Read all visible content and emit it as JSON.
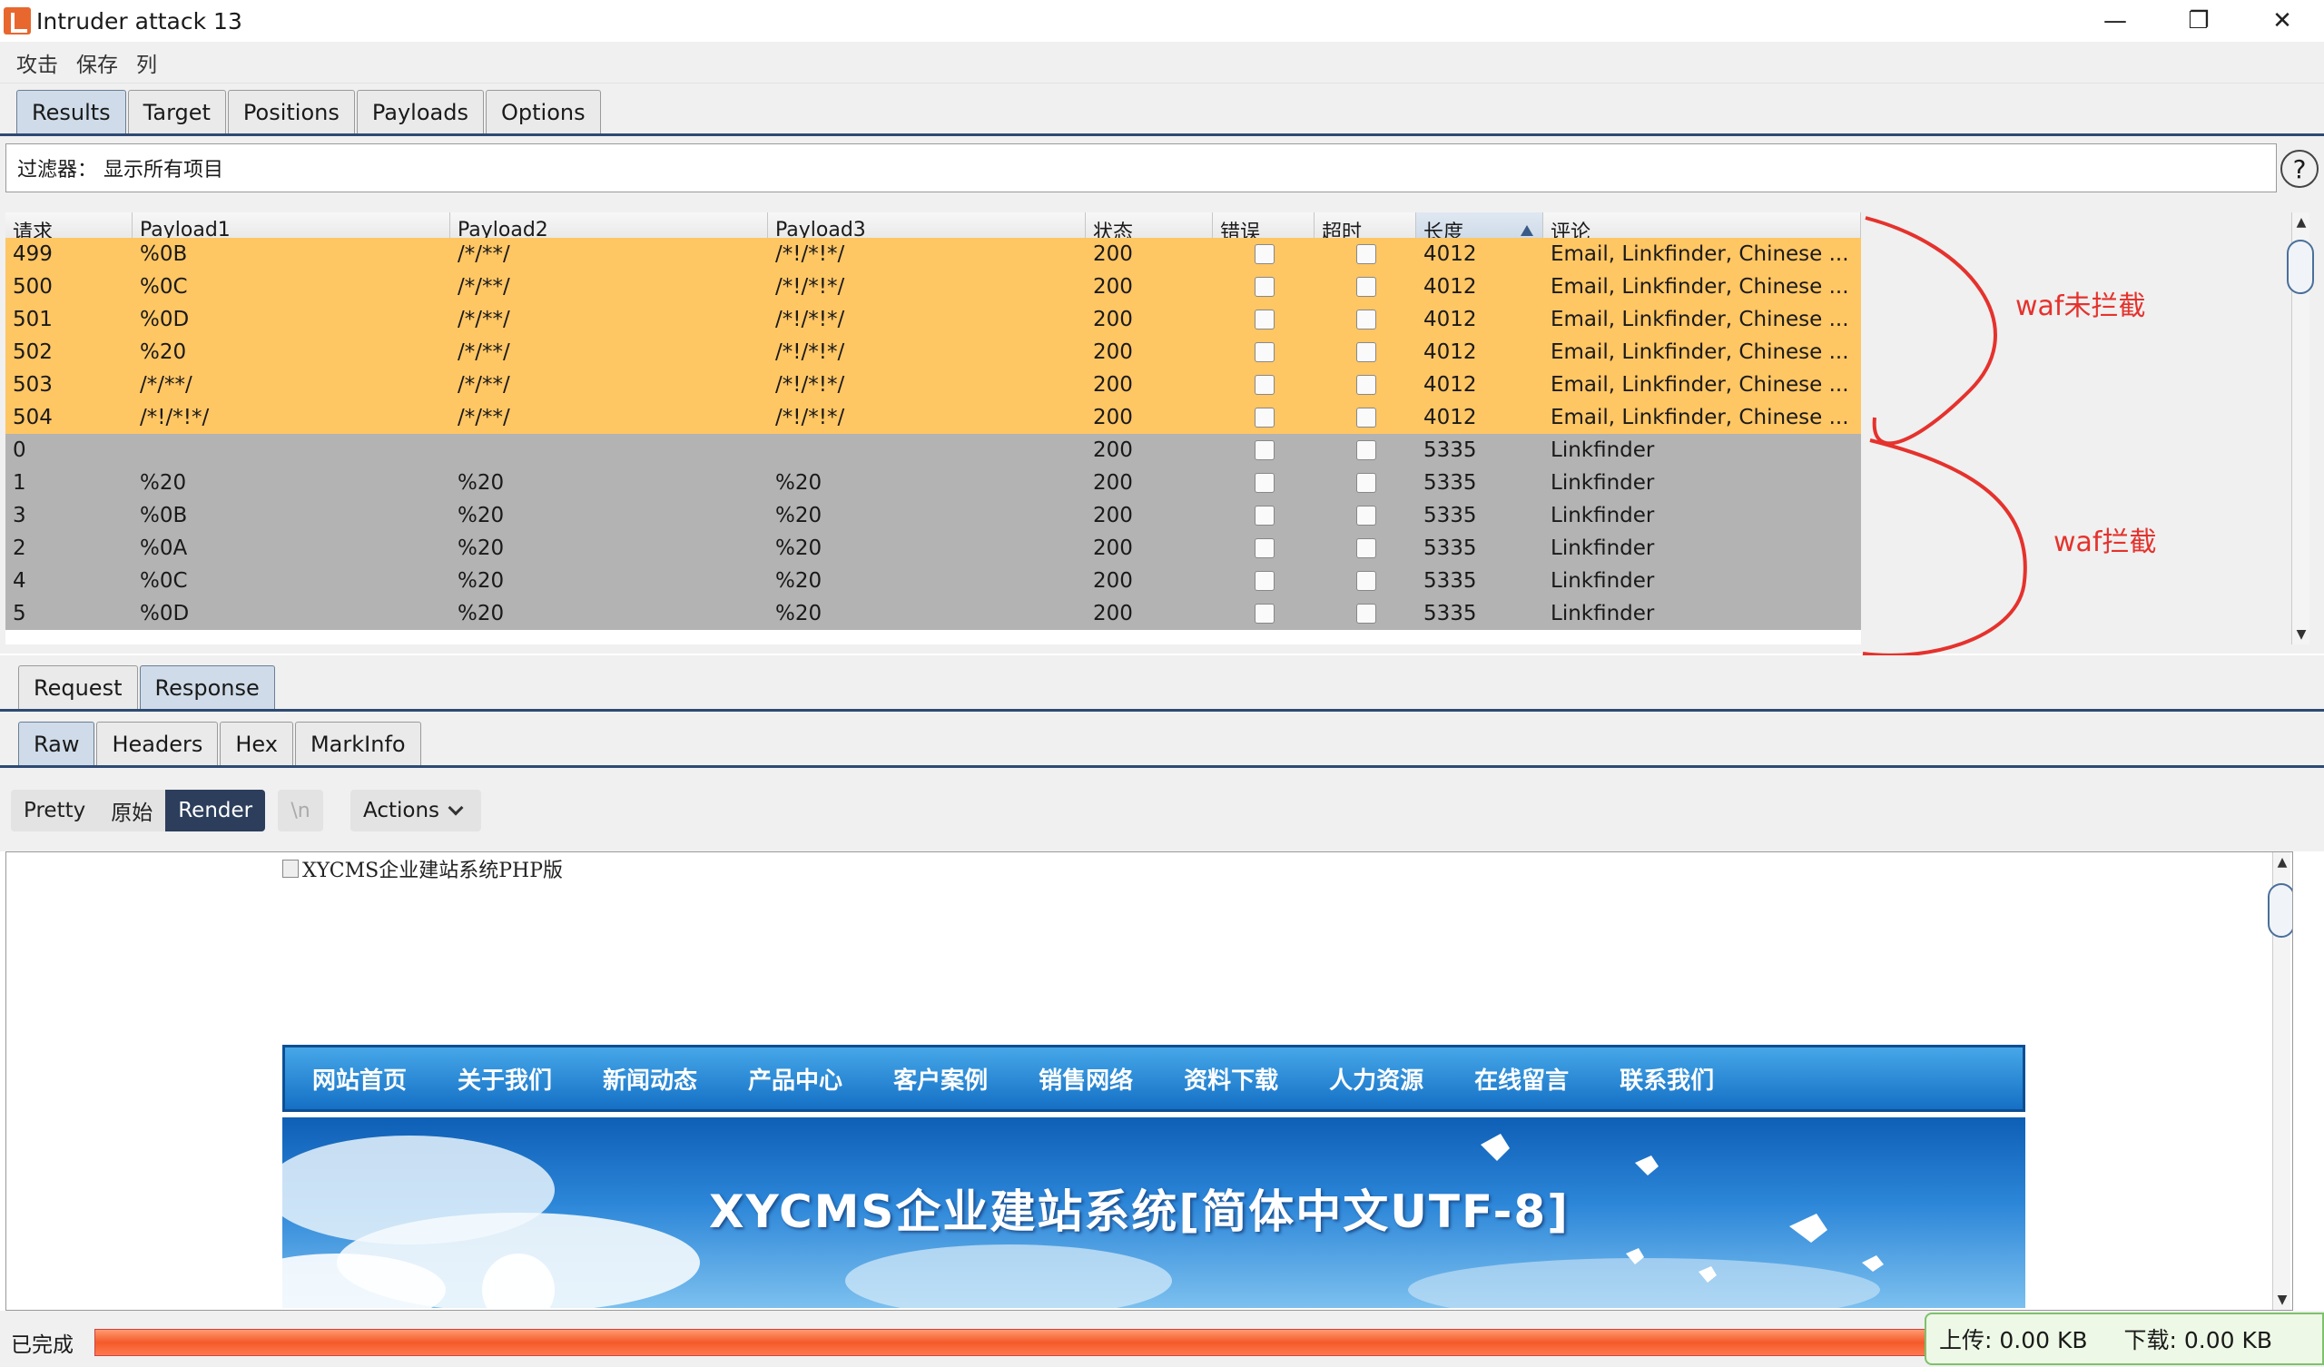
{
  "window": {
    "title": "Intruder attack 13",
    "minimize": "—",
    "maximize": "❐",
    "close": "✕"
  },
  "menu": [
    "攻击",
    "保存",
    "列"
  ],
  "tabs": [
    "Results",
    "Target",
    "Positions",
    "Payloads",
    "Options"
  ],
  "filter": {
    "label": "过滤器：  显示所有项目",
    "help": "?"
  },
  "table": {
    "columns": [
      "请求",
      "Payload1",
      "Payload2",
      "Payload3",
      "状态",
      "错误",
      "超时",
      "长度",
      "评论"
    ],
    "sorted_column": "长度",
    "rows": [
      [
        "499",
        "%0B",
        "/*/**/",
        "/*!/*!*/",
        "200",
        "4012",
        "Email, Linkfinder, Chinese ..."
      ],
      [
        "500",
        "%0C",
        "/*/**/",
        "/*!/*!*/",
        "200",
        "4012",
        "Email, Linkfinder, Chinese ..."
      ],
      [
        "501",
        "%0D",
        "/*/**/",
        "/*!/*!*/",
        "200",
        "4012",
        "Email, Linkfinder, Chinese ..."
      ],
      [
        "502",
        "%20",
        "/*/**/",
        "/*!/*!*/",
        "200",
        "4012",
        "Email, Linkfinder, Chinese ..."
      ],
      [
        "503",
        "/*/**/",
        "/*/**/",
        "/*!/*!*/",
        "200",
        "4012",
        "Email, Linkfinder, Chinese ..."
      ],
      [
        "504",
        "/*!/*!*/",
        "/*/**/",
        "/*!/*!*/",
        "200",
        "4012",
        "Email, Linkfinder, Chinese ..."
      ],
      [
        "0",
        "",
        "",
        "",
        "200",
        "5335",
        "Linkfinder"
      ],
      [
        "1",
        "%20",
        "%20",
        "%20",
        "200",
        "5335",
        "Linkfinder"
      ],
      [
        "3",
        "%0B",
        "%20",
        "%20",
        "200",
        "5335",
        "Linkfinder"
      ],
      [
        "2",
        "%0A",
        "%20",
        "%20",
        "200",
        "5335",
        "Linkfinder"
      ],
      [
        "4",
        "%0C",
        "%20",
        "%20",
        "200",
        "5335",
        "Linkfinder"
      ],
      [
        "5",
        "%0D",
        "%20",
        "%20",
        "200",
        "5335",
        "Linkfinder"
      ]
    ],
    "highlight_color": "#ffc664",
    "grey_color": "#b3b3b3"
  },
  "annotations": {
    "top": "waf未拦截",
    "bottom": "waf拦截",
    "color": "#e5322d"
  },
  "reqresp_tabs": [
    "Request",
    "Response"
  ],
  "view_tabs": [
    "Raw",
    "Headers",
    "Hex",
    "MarkInfo"
  ],
  "toolbar": {
    "modes": [
      "Pretty",
      "原始",
      "Render"
    ],
    "newline": "\\n",
    "actions": "Actions"
  },
  "render": {
    "img_alt": "XYCMS企业建站系统PHP版",
    "nav": [
      "网站首页",
      "关于我们",
      "新闻动态",
      "产品中心",
      "客户案例",
      "销售网络",
      "资料下载",
      "人力资源",
      "在线留言",
      "联系我们"
    ],
    "banner_title": "XYCMS企业建站系统[简体中文UTF-8]"
  },
  "status": {
    "text": "已完成",
    "upload": "上传: 0.00 KB",
    "download": "下载: 0.00 KB"
  }
}
